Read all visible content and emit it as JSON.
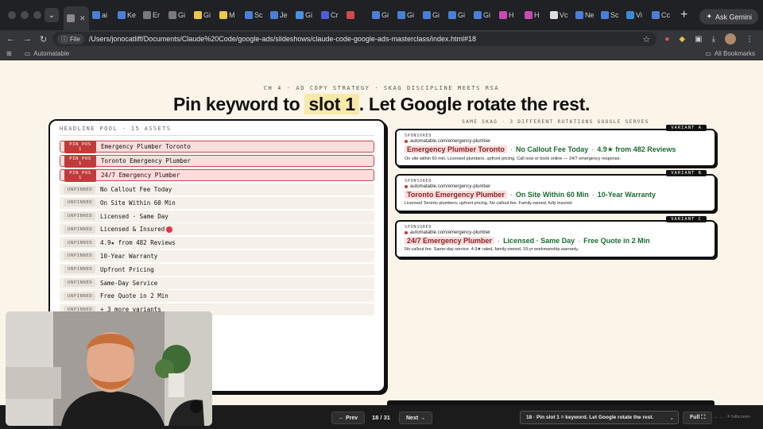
{
  "browser": {
    "tabs": [
      {
        "label": "",
        "fav": "#8a8a8a",
        "active": true
      },
      {
        "label": "ai",
        "fav": "#4a7fd6"
      },
      {
        "label": "Ke",
        "fav": "#4a7fd6"
      },
      {
        "label": "Er",
        "fav": "#7a7a7a"
      },
      {
        "label": "Gi",
        "fav": "#7a7a7a"
      },
      {
        "label": "Gi",
        "fav": "#e9c84a"
      },
      {
        "label": "M",
        "fav": "#e9c84a"
      },
      {
        "label": "Sc",
        "fav": "#4a7fd6"
      },
      {
        "label": "Je",
        "fav": "#4a7fd6"
      },
      {
        "label": "Gi",
        "fav": "#4a90e2"
      },
      {
        "label": "Cr",
        "fav": "#4a5fd6"
      },
      {
        "label": "",
        "fav": "#d04a4a"
      },
      {
        "label": "Gi",
        "fav": "#4a7fd6"
      },
      {
        "label": "Gi",
        "fav": "#4a7fd6"
      },
      {
        "label": "Gi",
        "fav": "#4a7fd6"
      },
      {
        "label": "Gi",
        "fav": "#4a7fd6"
      },
      {
        "label": "Gi",
        "fav": "#4a7fd6"
      },
      {
        "label": "H",
        "fav": "#c94ab0"
      },
      {
        "label": "H",
        "fav": "#c94ab0"
      },
      {
        "label": "Vc",
        "fav": "#dddddd"
      },
      {
        "label": "Ne",
        "fav": "#4a7fd6"
      },
      {
        "label": "Sc",
        "fav": "#4a7fd6"
      },
      {
        "label": "Vi",
        "fav": "#3a8ad6"
      },
      {
        "label": "Cc",
        "fav": "#4a7fd6"
      }
    ],
    "ask_gemini": "Ask Gemini",
    "omnibox_chip": "File",
    "url": "/Users/jonocatliff/Documents/Claude%20Code/google-ads/slideshows/claude-code-google-ads-masterclass/index.html#18",
    "bookmark_folder": "Automatable",
    "all_bookmarks": "All Bookmarks"
  },
  "slide": {
    "kicker": "CH 4 · AD COPY STRATEGY · SKAG DISCIPLINE MEETS RSA",
    "headline_pre": "Pin keyword to ",
    "headline_slot": "slot 1",
    "headline_post": ". Let Google rotate the rest.",
    "pool_title": "HEADLINE POOL · 15 ASSETS",
    "pool": [
      {
        "badge": "PIN POS 1",
        "text": "Emergency Plumber Toronto",
        "pinned": true
      },
      {
        "badge": "PIN POS 1",
        "text": "Toronto Emergency Plumber",
        "pinned": true
      },
      {
        "badge": "PIN POS 1",
        "text": "24/7 Emergency Plumber",
        "pinned": true
      },
      {
        "badge": "UNPINNED",
        "text": "No Callout Fee Today",
        "pinned": false
      },
      {
        "badge": "UNPINNED",
        "text": "On Site Within 60 Min",
        "pinned": false
      },
      {
        "badge": "UNPINNED",
        "text": "Licensed · Same Day",
        "pinned": false
      },
      {
        "badge": "UNPINNED",
        "text": "Licensed & Insured",
        "pinned": false
      },
      {
        "badge": "UNPINNED",
        "text": "4.9★ from 482 Reviews",
        "pinned": false
      },
      {
        "badge": "UNPINNED",
        "text": "10-Year Warranty",
        "pinned": false
      },
      {
        "badge": "UNPINNED",
        "text": "Upfront Pricing",
        "pinned": false
      },
      {
        "badge": "UNPINNED",
        "text": "Same-Day Service",
        "pinned": false
      },
      {
        "badge": "UNPINNED",
        "text": "Free Quote in 2 Min",
        "pinned": false
      },
      {
        "badge": "UNPINNED",
        "text": "+ 3 more variants",
        "pinned": false
      }
    ],
    "right_title": "SAME SKAG · 3 DIFFERENT ROTATIONS GOOGLE SERVES",
    "variants": [
      {
        "tag": "VARIANT A",
        "sponsored": "SPONSORED",
        "url": "automatable.com/emergency-plumber",
        "headlines": [
          "Emergency Plumber Toronto",
          "No Callout Fee Today",
          "4.9★ from 482 Reviews"
        ],
        "desc": "On site within 60 min. Licensed plumbers, upfront pricing. Call now or book online — 24/7 emergency response."
      },
      {
        "tag": "VARIANT B",
        "sponsored": "SPONSORED",
        "url": "automatable.com/emergency-plumber",
        "headlines": [
          "Toronto Emergency Plumber",
          "On Site Within 60 Min",
          "10-Year Warranty"
        ],
        "desc": "Licensed Toronto plumbers, upfront pricing. No callout fee. Family-owned, fully insured."
      },
      {
        "tag": "VARIANT C",
        "sponsored": "SPONSORED",
        "url": "automatable.com/emergency-plumber",
        "headlines": [
          "24/7 Emergency Plumber",
          "Licensed · Same Day",
          "Free Quote in 2 Min"
        ],
        "desc": "No callout fee. Same-day service. 4.9★ rated, family-owned, 10-yr workmanship warranty."
      }
    ]
  },
  "nav": {
    "prev": "← Prev",
    "counter": "18 / 31",
    "next": "Next →",
    "slide_select": "18 · Pin slot 1 = keyword. Let Google rotate the rest.",
    "full": "Full ⛶",
    "hint": "← → · F fullscreen"
  },
  "colors": {
    "slide_bg": "#fbf4e9",
    "pin_red": "#c13b3b",
    "ad_green": "#1b6b30",
    "slot_highlight": "#f7eaa9"
  }
}
